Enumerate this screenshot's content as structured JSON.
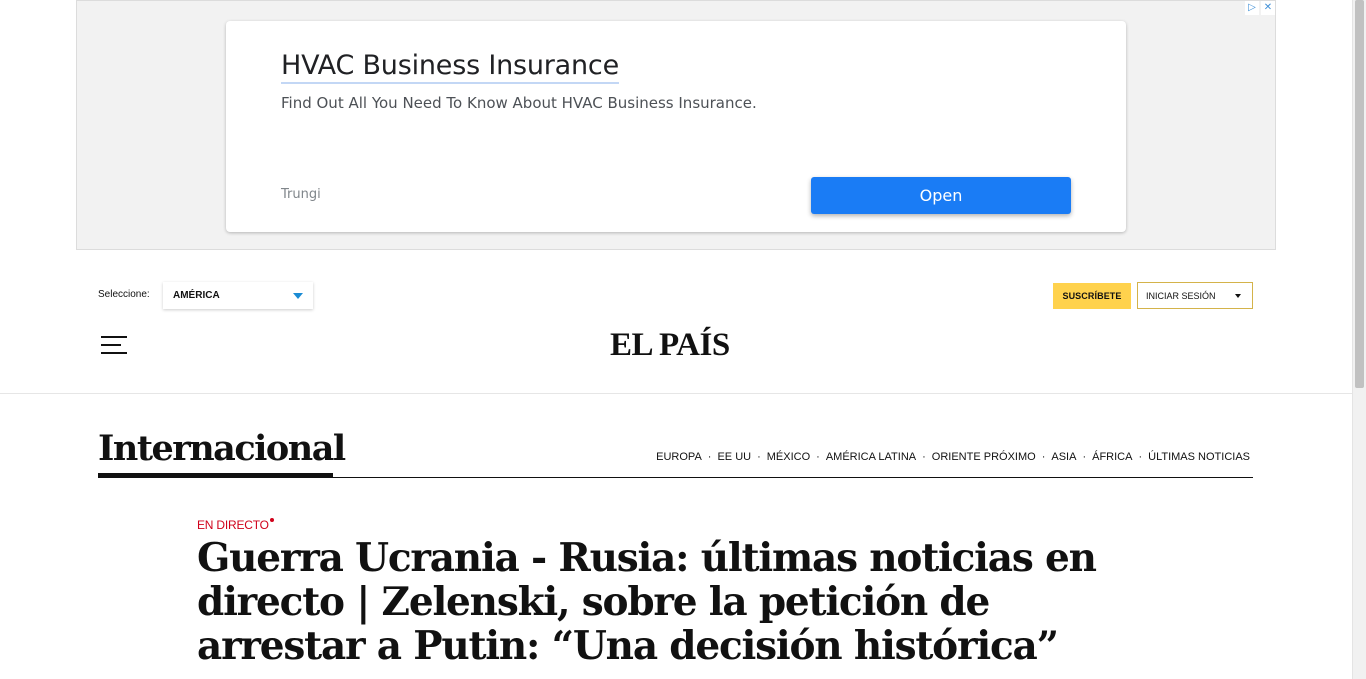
{
  "ad": {
    "title": "HVAC Business Insurance",
    "description": "Find Out All You Need To Know About HVAC Business Insurance.",
    "advertiser": "Trungi",
    "cta": "Open",
    "adchoices_icon": "adchoices-icon",
    "close_icon": "close-icon"
  },
  "header": {
    "edition_label": "Seleccione:",
    "edition_value": "AMÉRICA",
    "subscribe_label": "SUSCRÍBETE",
    "login_label": "INICIAR SESIÓN",
    "logo_text": "EL PAÍS"
  },
  "section": {
    "title": "Internacional",
    "nav": [
      {
        "label": "EUROPA"
      },
      {
        "label": "EE UU"
      },
      {
        "label": "MÉXICO"
      },
      {
        "label": "AMÉRICA LATINA"
      },
      {
        "label": "ORIENTE PRÓXIMO"
      },
      {
        "label": "ASIA"
      },
      {
        "label": "ÁFRICA"
      },
      {
        "label": "ÚLTIMAS NOTICIAS"
      }
    ],
    "separator": "·"
  },
  "article": {
    "tag": "EN DIRECTO",
    "headline": "Guerra Ucrania - Rusia: últimas noticias en directo | Zelenski, sobre la petición de arrestar a Putin: “Una decisión histórica”"
  },
  "colors": {
    "ad_button": "#1a7cf5",
    "subscribe": "#ffd24d",
    "live_red": "#d0021b",
    "select_caret": "#1a8bd4"
  }
}
